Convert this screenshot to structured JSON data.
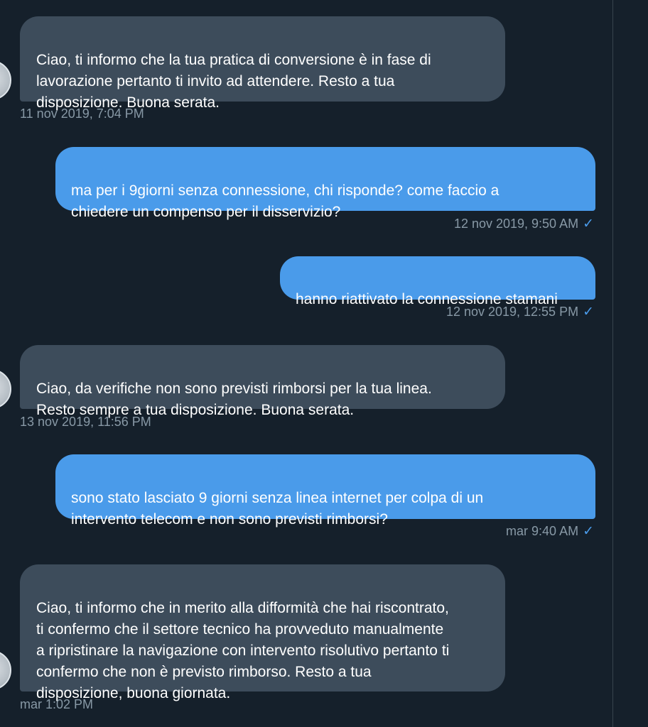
{
  "messages": [
    {
      "direction": "received",
      "text": "Ciao, ti informo che la tua pratica di conversione è in fase di\nlavorazione pertanto ti invito ad attendere. Resto a tua\ndisposizione. Buona serata.",
      "timestamp": "11 nov 2019, 7:04 PM"
    },
    {
      "direction": "sent",
      "text": "ma per i  9giorni senza connessione, chi risponde? come faccio a\nchiedere un compenso per il disservizio?",
      "timestamp": "12 nov 2019, 9:50 AM",
      "status_icon": "checkmark-icon"
    },
    {
      "direction": "sent",
      "text": "hanno riattivato la connessione stamani",
      "timestamp": "12 nov 2019, 12:55 PM",
      "status_icon": "checkmark-icon"
    },
    {
      "direction": "received",
      "text": "Ciao, da verifiche non sono previsti rimborsi per la tua linea.\nResto sempre a tua disposizione. Buona serata.",
      "timestamp": "13 nov 2019, 11:56 PM"
    },
    {
      "direction": "sent",
      "text": "sono stato lasciato 9 giorni senza linea internet per colpa di un\nintervento telecom e non sono previsti rimborsi?",
      "timestamp": "mar 9:40 AM",
      "status_icon": "checkmark-icon"
    },
    {
      "direction": "received",
      "text": "Ciao, ti informo che in merito alla difformità che hai riscontrato,\nti confermo che il settore tecnico ha provveduto manualmente\na ripristinare la navigazione con intervento risolutivo pertanto ti\nconfermo che non è previsto rimborso. Resto a tua\ndisposizione, buona giornata.",
      "timestamp": "mar 1:02 PM"
    }
  ],
  "colors": {
    "background": "#15202b",
    "received_bubble": "#3d4c5b",
    "sent_bubble": "#4a9bea",
    "timestamp": "#8899a6",
    "read_check": "#4a9bea"
  },
  "check_glyph": "✓"
}
